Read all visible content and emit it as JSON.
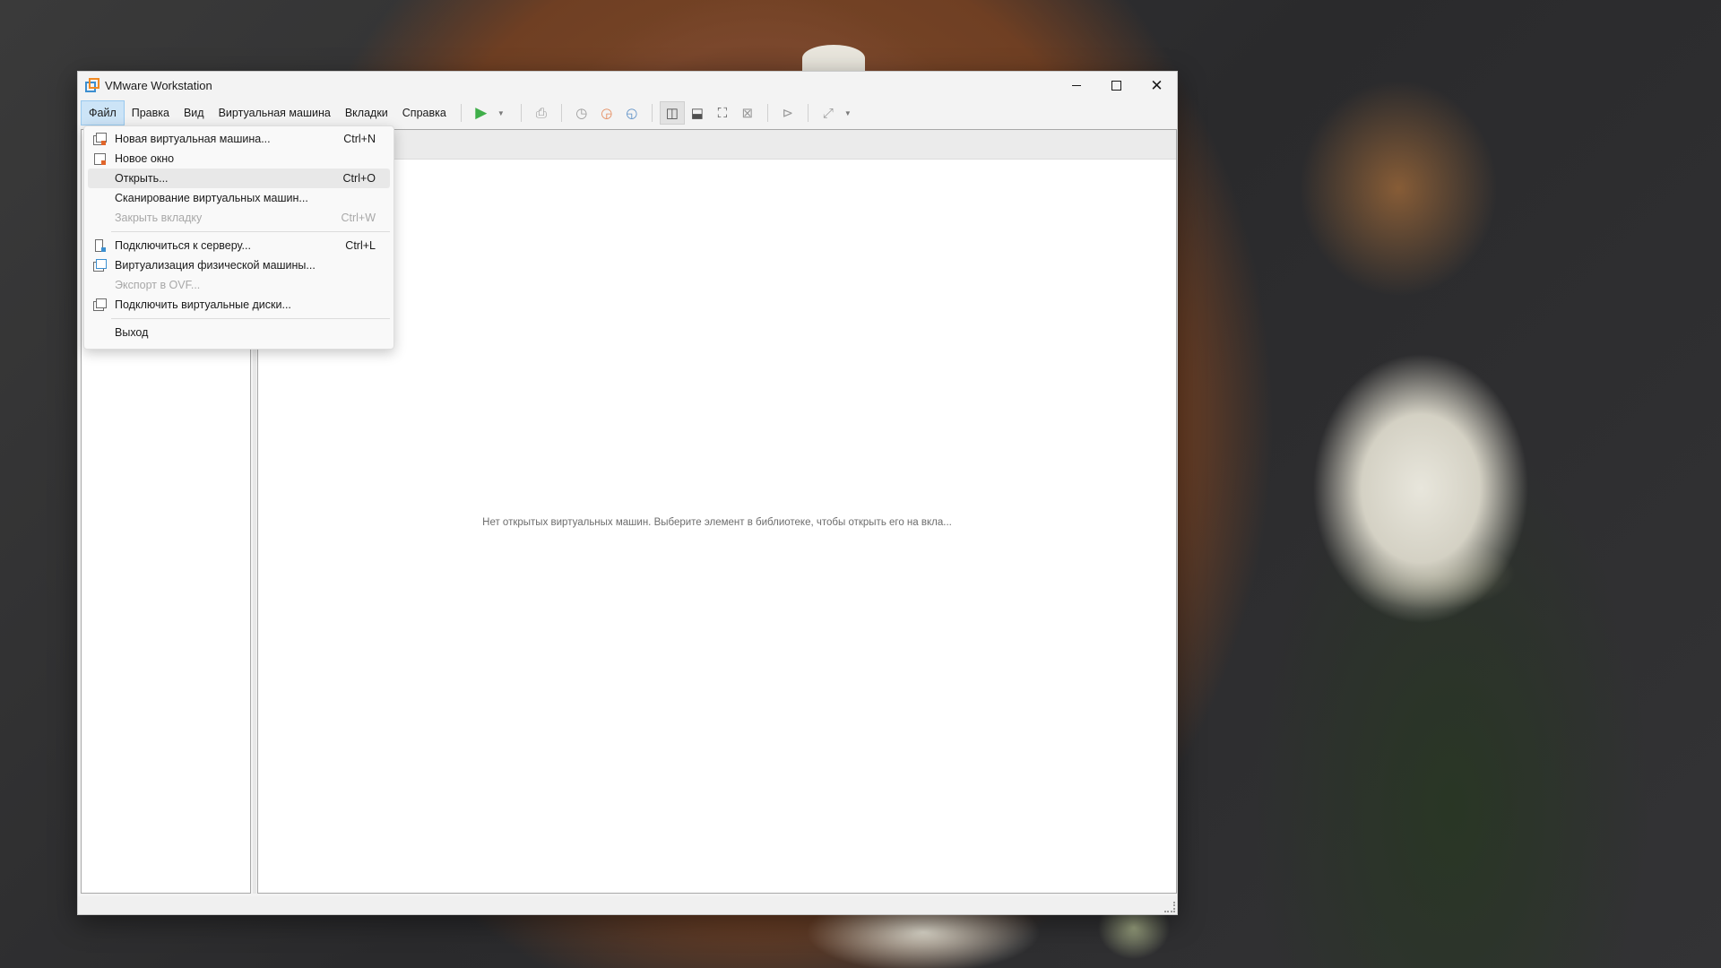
{
  "window": {
    "title": "VMware Workstation"
  },
  "menu": {
    "file": "Файл",
    "edit": "Правка",
    "view": "Вид",
    "vm": "Виртуальная машина",
    "tabs": "Вкладки",
    "help": "Справка"
  },
  "toolbar": {
    "icons": [
      "play-icon",
      "dropdown-arrow-icon",
      "send-keys-icon",
      "snapshot-icon",
      "revert-snapshot-icon",
      "snapshot-manager-icon",
      "library-view-icon",
      "thumbnail-bar-icon",
      "fullscreen-icon",
      "unity-icon",
      "console-view-icon",
      "stretch-view-icon"
    ]
  },
  "file_menu": {
    "items": [
      {
        "label": "Новая виртуальная машина...",
        "shortcut": "Ctrl+N",
        "icon": "new-vm-icon",
        "enabled": true
      },
      {
        "label": "Новое окно",
        "shortcut": "",
        "icon": "new-window-icon",
        "enabled": true
      },
      {
        "label": "Открыть...",
        "shortcut": "Ctrl+O",
        "icon": "",
        "enabled": true,
        "highlighted": true
      },
      {
        "label": "Сканирование виртуальных машин...",
        "shortcut": "",
        "icon": "",
        "enabled": true
      },
      {
        "label": "Закрыть вкладку",
        "shortcut": "Ctrl+W",
        "icon": "",
        "enabled": false
      },
      {
        "label": "Подключиться к серверу...",
        "shortcut": "Ctrl+L",
        "icon": "connect-server-icon",
        "enabled": true
      },
      {
        "label": "Виртуализация физической машины...",
        "shortcut": "",
        "icon": "virtualize-physical-icon",
        "enabled": true
      },
      {
        "label": "Экспорт в OVF...",
        "shortcut": "",
        "icon": "",
        "enabled": false
      },
      {
        "label": "Подключить виртуальные диски...",
        "shortcut": "",
        "icon": "map-disks-icon",
        "enabled": true
      },
      {
        "label": "Выход",
        "shortcut": "",
        "icon": "",
        "enabled": true
      }
    ]
  },
  "main": {
    "empty_message": "Нет открытых виртуальных машин. Выберите элемент в библиотеке, чтобы открыть его на вкла..."
  },
  "colors": {
    "menu_active_bg": "#cce4f7",
    "play_green": "#3fae49",
    "brand_orange": "#f08a24",
    "brand_blue": "#3c8fd0"
  }
}
